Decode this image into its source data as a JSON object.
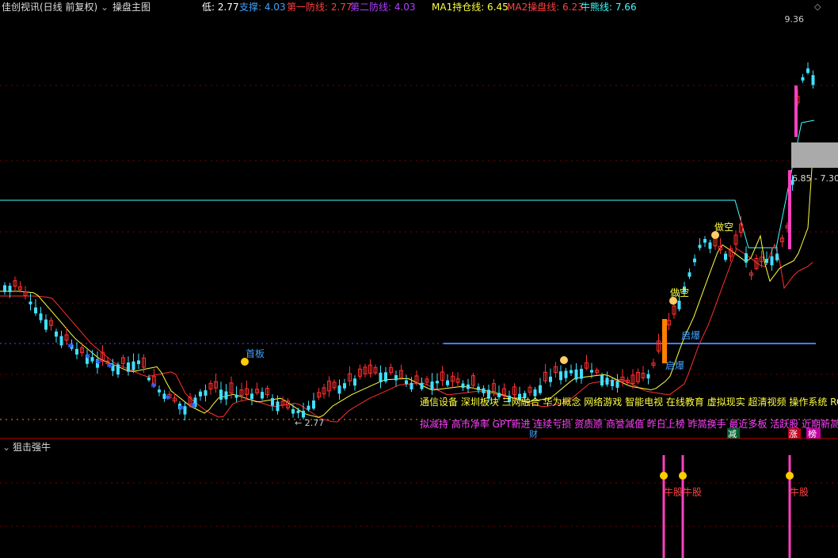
{
  "main_panel": {
    "title": "佳创视讯(日线 前复权)",
    "indicator_name": "操盘主图",
    "readouts": [
      {
        "label": "低",
        "value": "2.77",
        "color": "#ffffff"
      },
      {
        "label": "支撑",
        "value": "4.03",
        "color": "#3fa4ff"
      },
      {
        "label": "第一防线",
        "value": "2.77",
        "color": "#ff4040"
      },
      {
        "label": "第二防线",
        "value": "4.03",
        "color": "#b040ff"
      },
      {
        "label": "MA1持仓线",
        "value": "6.45",
        "color": "#ffff40"
      },
      {
        "label": "MA2操盘线",
        "value": "6.23",
        "color": "#ff4040"
      },
      {
        "label": "牛熊线",
        "value": "7.66",
        "color": "#40ffff"
      }
    ],
    "high_label": "9.36",
    "low_label": "2.77",
    "range_label": "6.85 - 7.30",
    "concepts_line1": "通信设备  深圳板块  三网融合  华为概念  网络游戏  智能电视  在线教育  虚拟现实  超清视频  操作系统  RC",
    "concepts_line2": "拟减持  高市净率  GPT新进  连续亏损  资质原  商誉减值  昨日上榜  昨高换手  最近多板  活跃股  近期新高  近",
    "annotations": [
      "首板",
      "做空",
      "做空",
      "启爆",
      "启爆",
      "财",
      "减",
      "涨",
      "榜"
    ]
  },
  "sub_panel": {
    "title": "狙击强牛",
    "signal_label": "牛股"
  },
  "colors": {
    "up": "#ff3030",
    "down": "#40e0ff",
    "ma_short": "#ffff40",
    "ma_long": "#ff3030",
    "bull_bear": "#40ffff",
    "support": "#3f7fff",
    "magenta": "#ff40c0",
    "grid": "#7a0000"
  }
}
